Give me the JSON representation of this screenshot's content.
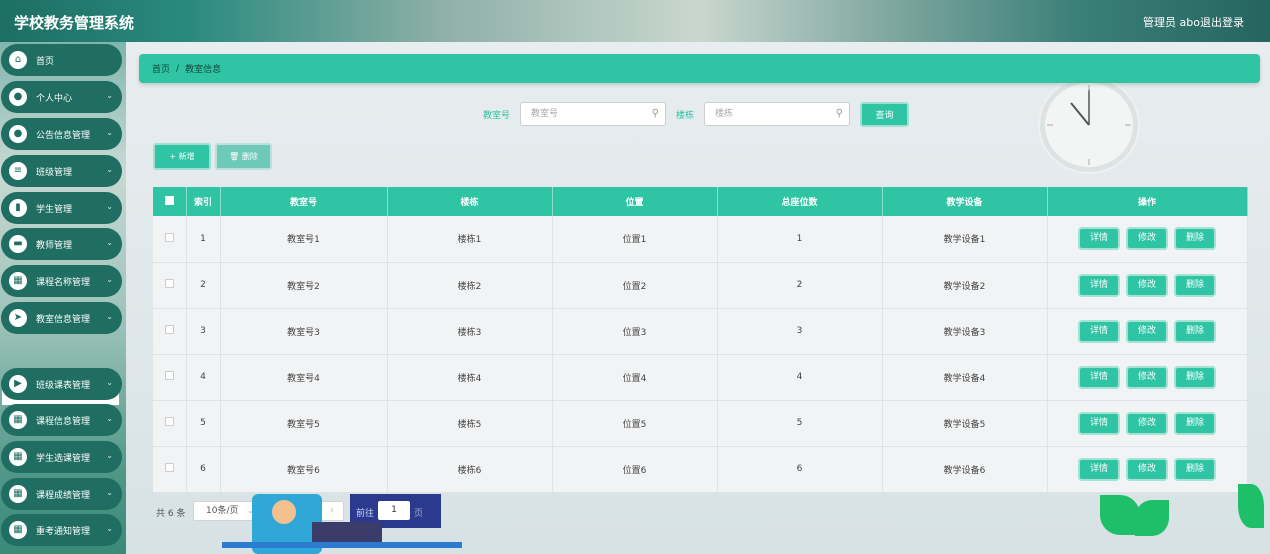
{
  "header": {
    "title": "学校教务管理系统",
    "admin": "管理员 abo",
    "logout": "退出登录"
  },
  "sidebar": {
    "items": [
      {
        "label": "首页",
        "icon": "home-icon",
        "glyph": "⌂",
        "expandable": false
      },
      {
        "label": "个人中心",
        "icon": "user-icon",
        "glyph": "●",
        "expandable": true
      },
      {
        "label": "公告信息管理",
        "icon": "person-icon",
        "glyph": "●",
        "expandable": true
      },
      {
        "label": "班级管理",
        "icon": "list-icon",
        "glyph": "≡",
        "expandable": true
      },
      {
        "label": "学生管理",
        "icon": "chart-icon",
        "glyph": "▮",
        "expandable": true
      },
      {
        "label": "教师管理",
        "icon": "briefcase-icon",
        "glyph": "▬",
        "expandable": true
      },
      {
        "label": "课程名称管理",
        "icon": "grid-icon",
        "glyph": "▦",
        "expandable": true
      },
      {
        "label": "教室信息管理",
        "icon": "send-icon",
        "glyph": "➤",
        "expandable": true
      },
      {
        "label": "班级课表管理",
        "icon": "video-icon",
        "glyph": "▶",
        "expandable": true
      },
      {
        "label": "课程信息管理",
        "icon": "grid-icon",
        "glyph": "▦",
        "expandable": true
      },
      {
        "label": "学生选课管理",
        "icon": "grid-icon",
        "glyph": "▦",
        "expandable": true
      },
      {
        "label": "课程成绩管理",
        "icon": "grid-icon",
        "glyph": "▦",
        "expandable": true
      },
      {
        "label": "重考通知管理",
        "icon": "grid-icon",
        "glyph": "▦",
        "expandable": true
      }
    ],
    "sub_item": "教室信息"
  },
  "breadcrumb": {
    "home": "首页",
    "sep": "/",
    "current": "教室信息"
  },
  "search": {
    "room_label": "教室号",
    "room_placeholder": "教室号",
    "building_label": "楼栋",
    "building_placeholder": "楼栋",
    "query_button": "查询"
  },
  "actions": {
    "add": "+ 新增",
    "delete": "🗑 删除"
  },
  "table": {
    "columns": [
      "",
      "索引",
      "教室号",
      "楼栋",
      "位置",
      "总座位数",
      "教学设备",
      "操作"
    ],
    "rows": [
      {
        "index": "1",
        "room": "教室号1",
        "building": "楼栋1",
        "location": "位置1",
        "seats": "1",
        "equipment": "教学设备1"
      },
      {
        "index": "2",
        "room": "教室号2",
        "building": "楼栋2",
        "location": "位置2",
        "seats": "2",
        "equipment": "教学设备2"
      },
      {
        "index": "3",
        "room": "教室号3",
        "building": "楼栋3",
        "location": "位置3",
        "seats": "3",
        "equipment": "教学设备3"
      },
      {
        "index": "4",
        "room": "教室号4",
        "building": "楼栋4",
        "location": "位置4",
        "seats": "4",
        "equipment": "教学设备4"
      },
      {
        "index": "5",
        "room": "教室号5",
        "building": "楼栋5",
        "location": "位置5",
        "seats": "5",
        "equipment": "教学设备5"
      },
      {
        "index": "6",
        "room": "教室号6",
        "building": "楼栋6",
        "location": "位置6",
        "seats": "6",
        "equipment": "教学设备6"
      }
    ],
    "op_labels": {
      "detail": "详情",
      "edit": "修改",
      "delete": "删除"
    }
  },
  "pagination": {
    "total": "共 6 条",
    "page_size": "10条/页",
    "current_page": "1",
    "goto_label": "前往",
    "goto_value": "1",
    "goto_suffix": "页"
  },
  "colors": {
    "accent": "#2ec4a4",
    "sidebar_item": "#1f6e61"
  }
}
